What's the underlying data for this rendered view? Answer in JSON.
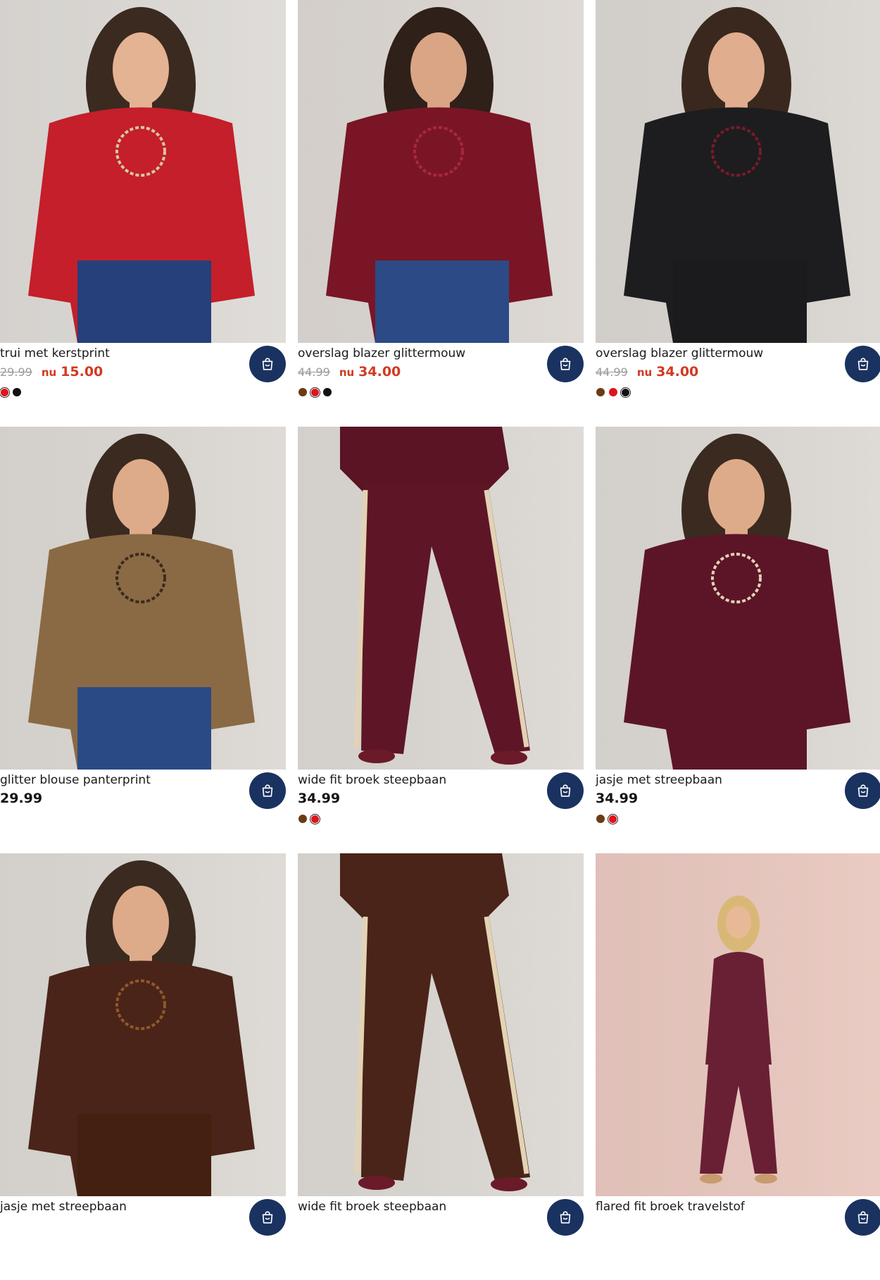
{
  "products": [
    {
      "name": "trui met kerstprint",
      "old_price": "29.99",
      "now_label": "nu",
      "price": "15.00",
      "on_sale": true,
      "swatches": [
        {
          "color": "#e0141b",
          "selected": true
        },
        {
          "color": "#111111",
          "selected": false
        }
      ],
      "photo": {
        "bg": "#dedbd7",
        "garment": "#c41f2a",
        "lower": "#25407a",
        "skin": "#e4b393",
        "hair": "#3b2a20",
        "accent": "#d9c9a0"
      },
      "cart_icon": "shopping-bag-icon"
    },
    {
      "name": "overslag blazer glittermouw",
      "old_price": "44.99",
      "now_label": "nu",
      "price": "34.00",
      "on_sale": true,
      "swatches": [
        {
          "color": "#6b3b16",
          "selected": false
        },
        {
          "color": "#e0141b",
          "selected": true
        },
        {
          "color": "#111111",
          "selected": false
        }
      ],
      "photo": {
        "bg": "#dcd7d2",
        "garment": "#7a1526",
        "lower": "#2c4a86",
        "skin": "#d9a585",
        "hair": "#2f2019",
        "accent": "#a8283c"
      },
      "cart_icon": "shopping-bag-icon"
    },
    {
      "name": "overslag blazer glittermouw",
      "old_price": "44.99",
      "now_label": "nu",
      "price": "34.00",
      "on_sale": true,
      "swatches": [
        {
          "color": "#6b3b16",
          "selected": false
        },
        {
          "color": "#e0141b",
          "selected": false
        },
        {
          "color": "#111111",
          "selected": true
        }
      ],
      "photo": {
        "bg": "#dad6d1",
        "garment": "#1d1d1f",
        "lower": "#1b1b1d",
        "skin": "#e0ad8e",
        "hair": "#3a281e",
        "accent": "#7a1a2a"
      },
      "cart_icon": "shopping-bag-icon"
    },
    {
      "name": "glitter blouse panterprint",
      "old_price": "",
      "now_label": "",
      "price": "29.99",
      "on_sale": false,
      "swatches": [],
      "photo": {
        "bg": "#dcd8d3",
        "garment": "#8a6a44",
        "lower": "#2a4a86",
        "skin": "#deab8a",
        "hair": "#3a2a20",
        "accent": "#3a2a1c"
      },
      "cart_icon": "shopping-bag-icon"
    },
    {
      "name": "wide fit broek steepbaan",
      "old_price": "",
      "now_label": "",
      "price": "34.99",
      "on_sale": false,
      "swatches": [
        {
          "color": "#6b3b16",
          "selected": false
        },
        {
          "color": "#e0141b",
          "selected": true
        }
      ],
      "photo": {
        "bg": "#dcd8d3",
        "garment": "#5a1424",
        "lower": "#5e1626",
        "skin": "#d6a584",
        "hair": "#3a2a20",
        "accent": "#e2d3b4"
      },
      "cart_icon": "shopping-bag-icon"
    },
    {
      "name": "jasje met streepbaan",
      "old_price": "",
      "now_label": "",
      "price": "34.99",
      "on_sale": false,
      "swatches": [
        {
          "color": "#6b3b16",
          "selected": false
        },
        {
          "color": "#e0141b",
          "selected": true
        }
      ],
      "photo": {
        "bg": "#dcd8d3",
        "garment": "#5c1527",
        "lower": "#5c1527",
        "skin": "#deab8a",
        "hair": "#3a2a20",
        "accent": "#e2d3b4"
      },
      "cart_icon": "shopping-bag-icon"
    },
    {
      "name": "jasje met streepbaan",
      "old_price": "",
      "now_label": "",
      "price": "",
      "on_sale": false,
      "swatches": [],
      "photo": {
        "bg": "#dcd8d3",
        "garment": "#4a2418",
        "lower": "#43200f",
        "skin": "#deab8a",
        "hair": "#3a2a20",
        "accent": "#8f5a2a"
      },
      "cart_icon": "shopping-bag-icon"
    },
    {
      "name": "wide fit broek steepbaan",
      "old_price": "",
      "now_label": "",
      "price": "",
      "on_sale": false,
      "swatches": [],
      "photo": {
        "bg": "#dcd8d3",
        "garment": "#4a2418",
        "lower": "#4a2418",
        "skin": "#d6a584",
        "hair": "#3a2a20",
        "accent": "#e2d3b4"
      },
      "cart_icon": "shopping-bag-icon"
    },
    {
      "name": "flared fit broek travelstof",
      "old_price": "",
      "now_label": "",
      "price": "",
      "on_sale": false,
      "swatches": [],
      "photo": {
        "bg": "#e9c8bf",
        "garment": "#6a2034",
        "lower": "#6a2034",
        "skin": "#e8b996",
        "hair": "#d9b877",
        "accent": "#c89a70"
      },
      "cart_icon": "shopping-bag-icon"
    }
  ]
}
